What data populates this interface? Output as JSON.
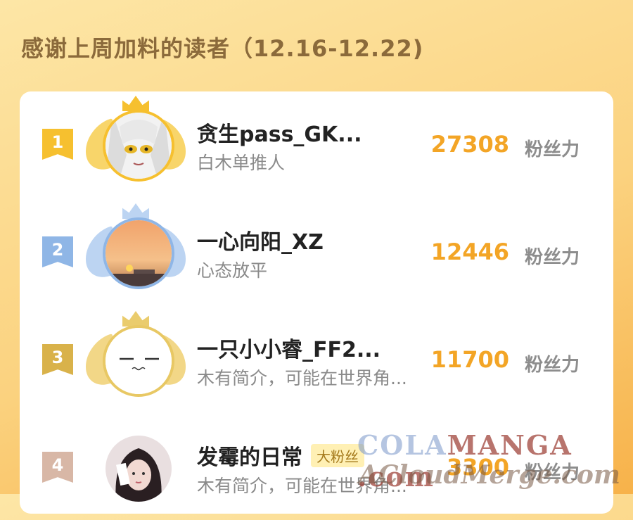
{
  "header": {
    "title": "感谢上周加料的读者（12.16-12.22)"
  },
  "colors": {
    "accent": "#f3a526",
    "rank1": "#f6c02f",
    "rank2": "#8fb6e6",
    "rank3": "#d9b24a",
    "rank4": "#d8b7a6"
  },
  "unit_label": "粉丝力",
  "rows": [
    {
      "rank": "1",
      "name": "贪生pass_GK...",
      "sub": "白木单推人",
      "score": "27308"
    },
    {
      "rank": "2",
      "name": "一心向阳_XZ",
      "sub": "心态放平",
      "score": "12446"
    },
    {
      "rank": "3",
      "name": "一只小小睿_FF2...",
      "sub": "木有简介，可能在世界角...",
      "score": "11700"
    },
    {
      "rank": "4",
      "name": "发霉的日常",
      "tag": "大粉丝",
      "sub": "木有简介，可能在世界角...",
      "score": "3300"
    }
  ],
  "watermark": {
    "line1a": "COLA",
    "line1b": "MANGA",
    "line1c": " .com",
    "line2": "ACloudMerge.com"
  }
}
